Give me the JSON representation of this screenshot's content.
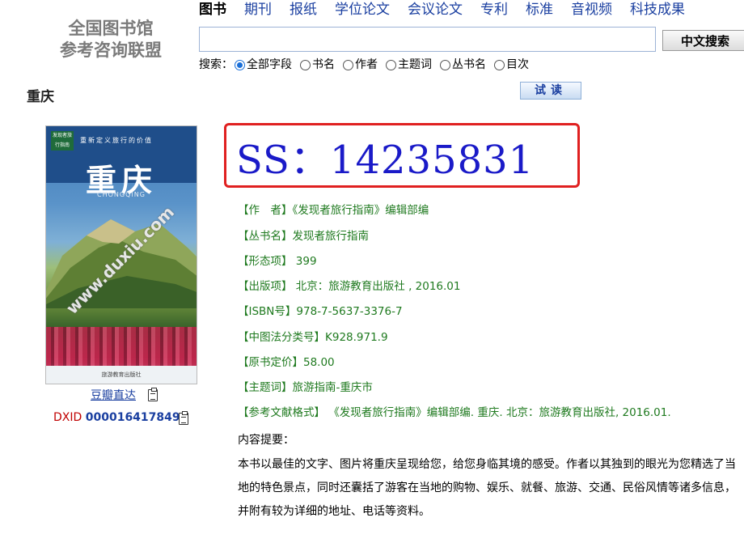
{
  "logo": {
    "line1": "全国图书馆",
    "line2": "参考咨询联盟"
  },
  "nav": {
    "items": [
      "图书",
      "期刊",
      "报纸",
      "学位论文",
      "会议论文",
      "专利",
      "标准",
      "音视频",
      "科技成果"
    ]
  },
  "search": {
    "value": "",
    "placeholder": "",
    "button_label": "中文搜索"
  },
  "scope": {
    "label": "搜索：",
    "options": [
      "全部字段",
      "书名",
      "作者",
      "主题词",
      "丛书名",
      "目次"
    ],
    "selected": "全部字段"
  },
  "book": {
    "title": "重庆",
    "trial_label": "试读",
    "cover": {
      "badge": "发现者旅行指南",
      "slogan": "重新定义旅行的价值",
      "title": "重庆",
      "pinyin": "CHONGQING",
      "watermark": "www.duxiu.com",
      "publisher": "旅游教育出版社"
    },
    "douban_label": "豆瓣直达",
    "dxid_label": "DXID",
    "dxid_value": "000016417849",
    "ss": "SS：14235831",
    "meta": [
      {
        "key": "【作　者】",
        "value": "《发现者旅行指南》编辑部编"
      },
      {
        "key": "【丛书名】",
        "value": "发现者旅行指南"
      },
      {
        "key": "【形态项】",
        "value": " 399"
      },
      {
        "key": "【出版项】",
        "value": " 北京：旅游教育出版社 , 2016.01"
      },
      {
        "key": "【ISBN号】",
        "value": "978-7-5637-3376-7"
      },
      {
        "key": "【中图法分类号】",
        "value": "K928.971.9"
      },
      {
        "key": "【原书定价】",
        "value": "58.00"
      },
      {
        "key": "【主题词】",
        "value": "旅游指南-重庆市"
      },
      {
        "key": "【参考文献格式】",
        "value": " 《发现者旅行指南》编辑部编. 重庆. 北京：旅游教育出版社, 2016.01."
      }
    ],
    "summary_title": "内容提要：",
    "summary": "本书以最佳的文字、图片将重庆呈现给您，给您身临其境的感受。作者以其独到的眼光为您精选了当地的特色景点，同时还囊括了游客在当地的购物、娱乐、就餐、旅游、交通、民俗风情等诸多信息，并附有较为详细的地址、电话等资料。"
  },
  "colors": {
    "link": "#1a3fa0",
    "meta_green": "#1f7a1f",
    "highlight_red": "#e02020",
    "ss_blue": "#1a1ac8",
    "dxid_red": "#c00000"
  }
}
